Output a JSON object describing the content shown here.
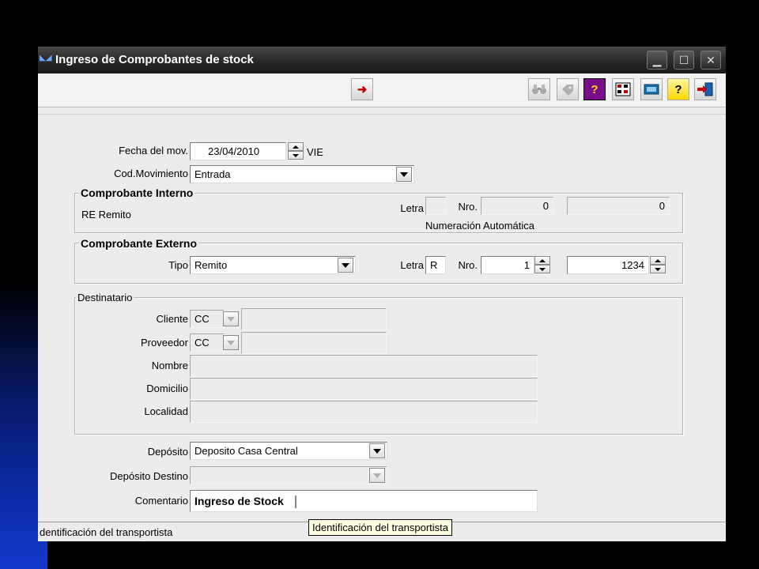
{
  "window": {
    "title": "Ingreso de Comprobantes de stock",
    "controls": {
      "minimize": "▁",
      "maximize": "☐",
      "close": "✕"
    }
  },
  "toolbar": {
    "next_icon": "➜",
    "help_icon": "?",
    "help2_icon": "?"
  },
  "form": {
    "fecha": {
      "label": "Fecha del mov.",
      "value": "23/04/2010",
      "day": "VIE"
    },
    "cod_movimiento": {
      "label": "Cod.Movimiento",
      "value": "Entrada"
    },
    "comprobante_interno": {
      "legend": "Comprobante Interno",
      "tipo_text": "RE Remito",
      "letra_label": "Letra",
      "letra_value": "",
      "nro_label": "Nro.",
      "nro_value": "0",
      "nro2_value": "0",
      "note": "Numeración Automática"
    },
    "comprobante_externo": {
      "legend": "Comprobante  Externo",
      "tipo_label": "Tipo",
      "tipo_value": "Remito",
      "letra_label": "Letra",
      "letra_value": "R",
      "nro_label": "Nro.",
      "nro_value": "1",
      "nro2_value": "1234"
    },
    "destinatario": {
      "legend": "Destinatario",
      "cliente_label": "Cliente",
      "cliente_value": "CC",
      "proveedor_label": "Proveedor",
      "proveedor_value": "CC",
      "nombre_label": "Nombre",
      "domicilio_label": "Domicilio",
      "localidad_label": "Localidad"
    },
    "deposito": {
      "label": "Depósito",
      "value": "Deposito Casa Central"
    },
    "deposito_destino": {
      "label": "Depósito Destino",
      "value": ""
    },
    "comentario": {
      "label": "Comentario",
      "value": "Ingreso de Stock"
    }
  },
  "status": {
    "text": "dentificación del transportista",
    "tooltip": "Identificación del transportista"
  },
  "colors": {
    "arrow": "#c00000",
    "help_bg": "#7a0b8a",
    "help_fg": "#ffd800"
  }
}
